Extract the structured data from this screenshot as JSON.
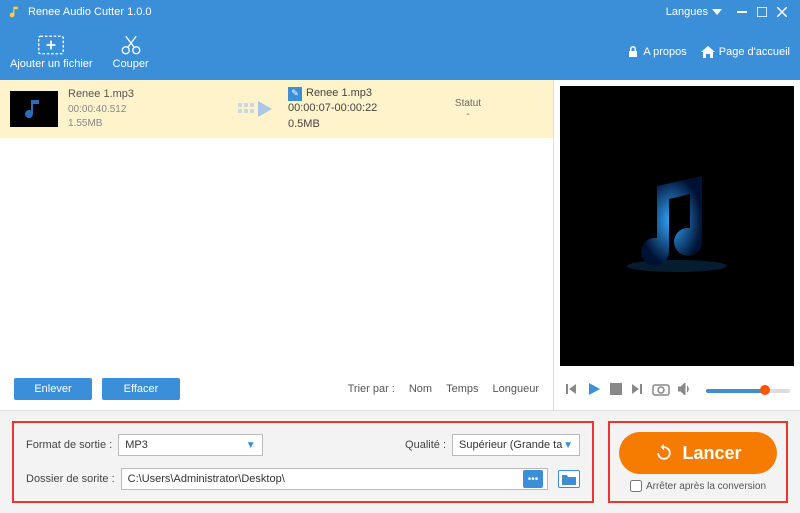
{
  "titlebar": {
    "title": "Renee Audio Cutter 1.0.0",
    "language": "Langues"
  },
  "toolbar": {
    "add_file": "Ajouter un fichier",
    "cut": "Couper",
    "about": "A propos",
    "home": "Page d'accueil"
  },
  "filelist": {
    "items": [
      {
        "src_name": "Renee 1.mp3",
        "src_duration": "00:00:40.512",
        "src_size": "1.55MB",
        "out_name": "Renee 1.mp3",
        "out_range": "00:00:07-00:00:22",
        "out_size": "0.5MB"
      }
    ],
    "status_header": "Statut",
    "status_value": "-"
  },
  "listfooter": {
    "remove": "Enlever",
    "clear": "Effacer",
    "sort_by": "Trier par :",
    "sort_name": "Nom",
    "sort_time": "Temps",
    "sort_length": "Longueur"
  },
  "settings": {
    "format_label": "Format de sortie :",
    "format_value": "MP3",
    "quality_label": "Qualité :",
    "quality_value": "Supérieur (Grande ta",
    "folder_label": "Dossier de sorite :",
    "folder_value": "C:\\Users\\Administrator\\Desktop\\"
  },
  "launch": {
    "button": "Lancer",
    "stop_after": "Arrêter après la conversion"
  }
}
